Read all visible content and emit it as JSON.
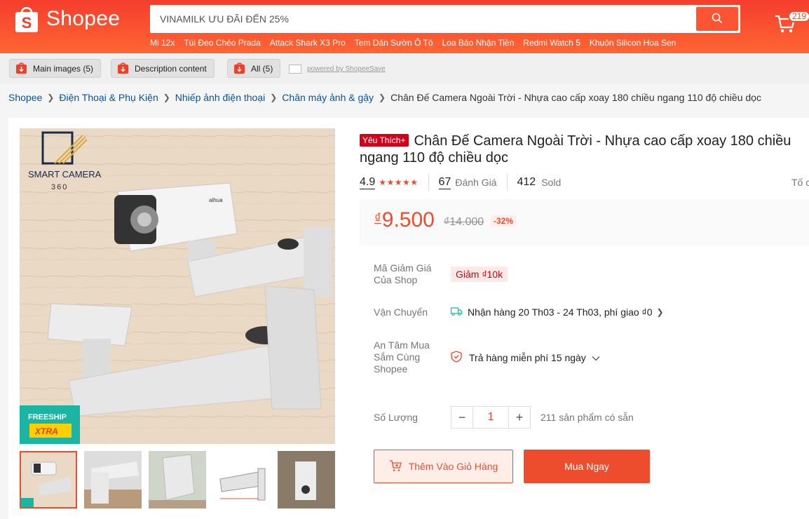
{
  "header": {
    "logo_text": "Shopee",
    "search_value": "VINAMILK ƯU ĐÃI ĐẾN 25%",
    "cart_count": "219",
    "hotwords": [
      "Mi 12x",
      "Túi Đeo Chéo Prada",
      "Attack Shark X3 Pro",
      "Tem Dán Sườn Ô Tô",
      "Loa Báo Nhận Tiền",
      "Redmi Watch 5",
      "Khuôn Silicon Hoa Sen"
    ],
    "brand_color": "#ee4d2d"
  },
  "extension": {
    "main_images": "Main images (5)",
    "description": "Description content",
    "all": "All (5)",
    "powered": "powered by ShopeeSave"
  },
  "breadcrumb": {
    "items": [
      "Shopee",
      "Điện Thoại & Phụ Kiện",
      "Nhiếp ảnh điện thoại",
      "Chân máy ảnh & gậy"
    ],
    "current": "Chân Đế Camera Ngoài Trời - Nhựa cao cấp xoay 180 chiều ngang 110 độ chiều dọc"
  },
  "gallery": {
    "brand_line1": "SMART CAMERA",
    "brand_line2": "360",
    "camera_brand": "alhua",
    "freeship_line1": "FREESHIP",
    "freeship_line2": "XTRA",
    "thumbnail_count": 5
  },
  "product": {
    "badge": "Yêu Thích+",
    "title": "Chân Đế Camera Ngoài Trời - Nhựa cao cấp xoay 180 chiều ngang 110 độ chiều dọc",
    "rating": "4.9",
    "reviews_count": "67",
    "reviews_label": "Đánh Giá",
    "sold_count": "412",
    "sold_label": "Sold",
    "report": "Tố cáo",
    "currency": "₫",
    "price": "9.500",
    "original_price": "₫14.000",
    "discount": "-32%"
  },
  "details": {
    "voucher_label": "Mã Giảm Giá Của Shop",
    "voucher_value": "Giảm ₫10k",
    "shipping_label": "Vận Chuyển",
    "shipping_value": "Nhận hàng 20 Th03 - 24 Th03, phí giao ₫0",
    "guarantee_label": "An Tâm Mua Sắm Cùng Shopee",
    "guarantee_value": "Trả hàng miễn phí 15 ngày",
    "quantity_label": "Số Lượng",
    "quantity_value": "1",
    "stock": "211 sản phẩm có sẵn"
  },
  "actions": {
    "add_to_cart": "Thêm Vào Giỏ Hàng",
    "buy_now": "Mua Ngay"
  }
}
